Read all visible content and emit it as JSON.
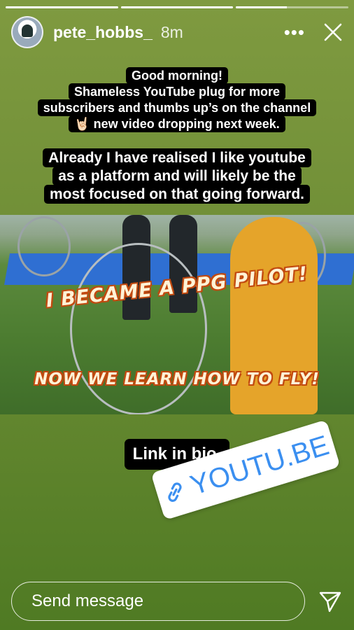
{
  "progress": [
    1,
    1,
    0.45
  ],
  "header": {
    "username": "pete_hobbs_",
    "time": "8m",
    "more_icon": "more-icon",
    "close_icon": "close-icon"
  },
  "captions": {
    "top_lines": [
      "Good morning!",
      "Shameless YouTube plug for more",
      "subscribers and thumbs up’s on the channel",
      "🤘🏻 new video dropping next week."
    ],
    "second_lines": [
      "Already I have realised I like youtube",
      "as a platform and will likely be the",
      "most focused on that going forward."
    ]
  },
  "photo": {
    "headline": "I BECAME A PPG PILOT!",
    "subline": "NOW WE LEARN HOW TO FLY!"
  },
  "link_caption": "Link in bio.",
  "sticker": {
    "icon": "link-icon",
    "text": "YOUTU.BE",
    "color": "#3b8ff0"
  },
  "footer": {
    "placeholder": "Send message",
    "send_icon": "send-icon"
  },
  "colors": {
    "background_top": "#7f9a40",
    "background_bottom": "#4f7a23"
  }
}
